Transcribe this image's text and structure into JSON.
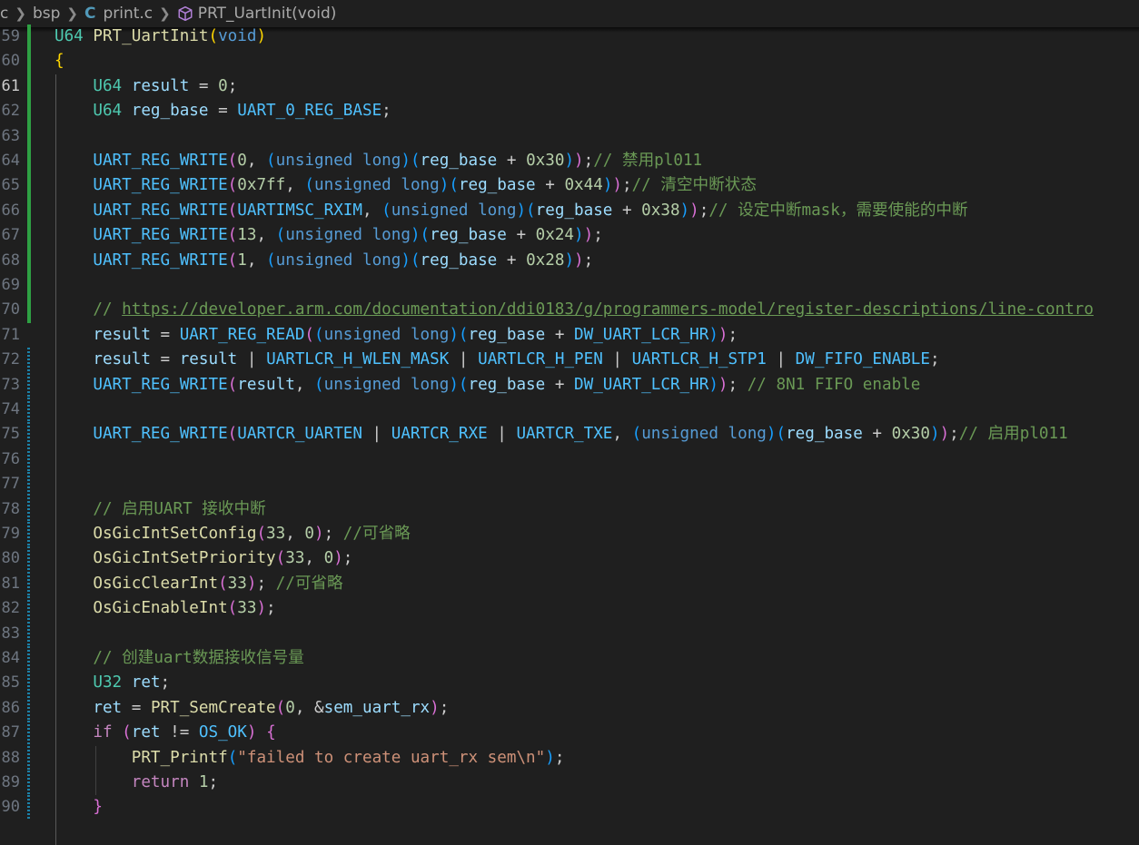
{
  "breadcrumb": {
    "items": [
      "c",
      "bsp",
      "print.c",
      "PRT_UartInit(void)"
    ],
    "icons": [
      "chevron-right-icon",
      "c-file-icon",
      "symbol-method-icon"
    ]
  },
  "editor": {
    "active_line": 61,
    "lines": [
      {
        "n": "59",
        "gutter": "added",
        "tokens": [
          [
            "U64",
            "type"
          ],
          [
            " ",
            "punc"
          ],
          [
            "PRT_UartInit",
            "fn"
          ],
          [
            "(",
            "p1"
          ],
          [
            "void",
            "kw"
          ],
          [
            ")",
            "p1"
          ]
        ]
      },
      {
        "n": "60",
        "gutter": "added",
        "tokens": [
          [
            "{",
            "p1"
          ]
        ]
      },
      {
        "n": "61",
        "gutter": "added",
        "tokens": [
          [
            "    ",
            "punc"
          ],
          [
            "U64",
            "type"
          ],
          [
            " ",
            "punc"
          ],
          [
            "result",
            "var"
          ],
          [
            " = ",
            "punc"
          ],
          [
            "0",
            "num"
          ],
          [
            ";",
            "punc"
          ]
        ]
      },
      {
        "n": "62",
        "gutter": "added",
        "tokens": [
          [
            "    ",
            "punc"
          ],
          [
            "U64",
            "type"
          ],
          [
            " ",
            "punc"
          ],
          [
            "reg_base",
            "var"
          ],
          [
            " = ",
            "punc"
          ],
          [
            "UART_0_REG_BASE",
            "macro"
          ],
          [
            ";",
            "punc"
          ]
        ]
      },
      {
        "n": "63",
        "gutter": "added",
        "tokens": []
      },
      {
        "n": "64",
        "gutter": "added",
        "tokens": [
          [
            "    ",
            "punc"
          ],
          [
            "UART_REG_WRITE",
            "macro"
          ],
          [
            "(",
            "p2"
          ],
          [
            "0",
            "num"
          ],
          [
            ", ",
            "punc"
          ],
          [
            "(",
            "p3"
          ],
          [
            "unsigned long",
            "kw"
          ],
          [
            ")",
            "p3"
          ],
          [
            "(",
            "p3"
          ],
          [
            "reg_base",
            "var"
          ],
          [
            " + ",
            "punc"
          ],
          [
            "0x30",
            "num"
          ],
          [
            ")",
            "p3"
          ],
          [
            ")",
            "p2"
          ],
          [
            ";",
            "punc"
          ],
          [
            "// 禁用pl011",
            "cmt"
          ]
        ]
      },
      {
        "n": "65",
        "gutter": "added",
        "tokens": [
          [
            "    ",
            "punc"
          ],
          [
            "UART_REG_WRITE",
            "macro"
          ],
          [
            "(",
            "p2"
          ],
          [
            "0x7ff",
            "num"
          ],
          [
            ", ",
            "punc"
          ],
          [
            "(",
            "p3"
          ],
          [
            "unsigned long",
            "kw"
          ],
          [
            ")",
            "p3"
          ],
          [
            "(",
            "p3"
          ],
          [
            "reg_base",
            "var"
          ],
          [
            " + ",
            "punc"
          ],
          [
            "0x44",
            "num"
          ],
          [
            ")",
            "p3"
          ],
          [
            ")",
            "p2"
          ],
          [
            ";",
            "punc"
          ],
          [
            "// 清空中断状态",
            "cmt"
          ]
        ]
      },
      {
        "n": "66",
        "gutter": "added",
        "tokens": [
          [
            "    ",
            "punc"
          ],
          [
            "UART_REG_WRITE",
            "macro"
          ],
          [
            "(",
            "p2"
          ],
          [
            "UARTIMSC_RXIM",
            "macro"
          ],
          [
            ", ",
            "punc"
          ],
          [
            "(",
            "p3"
          ],
          [
            "unsigned long",
            "kw"
          ],
          [
            ")",
            "p3"
          ],
          [
            "(",
            "p3"
          ],
          [
            "reg_base",
            "var"
          ],
          [
            " + ",
            "punc"
          ],
          [
            "0x38",
            "num"
          ],
          [
            ")",
            "p3"
          ],
          [
            ")",
            "p2"
          ],
          [
            ";",
            "punc"
          ],
          [
            "// 设定中断mask，需要使能的中断",
            "cmt"
          ]
        ]
      },
      {
        "n": "67",
        "gutter": "added",
        "tokens": [
          [
            "    ",
            "punc"
          ],
          [
            "UART_REG_WRITE",
            "macro"
          ],
          [
            "(",
            "p2"
          ],
          [
            "13",
            "num"
          ],
          [
            ", ",
            "punc"
          ],
          [
            "(",
            "p3"
          ],
          [
            "unsigned long",
            "kw"
          ],
          [
            ")",
            "p3"
          ],
          [
            "(",
            "p3"
          ],
          [
            "reg_base",
            "var"
          ],
          [
            " + ",
            "punc"
          ],
          [
            "0x24",
            "num"
          ],
          [
            ")",
            "p3"
          ],
          [
            ")",
            "p2"
          ],
          [
            ";",
            "punc"
          ]
        ]
      },
      {
        "n": "68",
        "gutter": "added",
        "tokens": [
          [
            "    ",
            "punc"
          ],
          [
            "UART_REG_WRITE",
            "macro"
          ],
          [
            "(",
            "p2"
          ],
          [
            "1",
            "num"
          ],
          [
            ", ",
            "punc"
          ],
          [
            "(",
            "p3"
          ],
          [
            "unsigned long",
            "kw"
          ],
          [
            ")",
            "p3"
          ],
          [
            "(",
            "p3"
          ],
          [
            "reg_base",
            "var"
          ],
          [
            " + ",
            "punc"
          ],
          [
            "0x28",
            "num"
          ],
          [
            ")",
            "p3"
          ],
          [
            ")",
            "p2"
          ],
          [
            ";",
            "punc"
          ]
        ]
      },
      {
        "n": "69",
        "gutter": "added",
        "tokens": []
      },
      {
        "n": "70",
        "gutter": "added",
        "tokens": [
          [
            "    ",
            "punc"
          ],
          [
            "// ",
            "cmt"
          ],
          [
            "https://developer.arm.com/documentation/ddi0183/g/programmers-model/register-descriptions/line-contro",
            "link"
          ]
        ]
      },
      {
        "n": "71",
        "gutter": "none",
        "tokens": [
          [
            "    ",
            "punc"
          ],
          [
            "result",
            "var"
          ],
          [
            " = ",
            "punc"
          ],
          [
            "UART_REG_READ",
            "macro"
          ],
          [
            "(",
            "p2"
          ],
          [
            "(",
            "p3"
          ],
          [
            "unsigned long",
            "kw"
          ],
          [
            ")",
            "p3"
          ],
          [
            "(",
            "p3"
          ],
          [
            "reg_base",
            "var"
          ],
          [
            " + ",
            "punc"
          ],
          [
            "DW_UART_LCR_HR",
            "macro"
          ],
          [
            ")",
            "p3"
          ],
          [
            ")",
            "p2"
          ],
          [
            ";",
            "punc"
          ]
        ]
      },
      {
        "n": "72",
        "gutter": "modified",
        "tokens": [
          [
            "    ",
            "punc"
          ],
          [
            "result",
            "var"
          ],
          [
            " = ",
            "punc"
          ],
          [
            "result",
            "var"
          ],
          [
            " | ",
            "punc"
          ],
          [
            "UARTLCR_H_WLEN_MASK",
            "macro"
          ],
          [
            " | ",
            "punc"
          ],
          [
            "UARTLCR_H_PEN",
            "macro"
          ],
          [
            " | ",
            "punc"
          ],
          [
            "UARTLCR_H_STP1",
            "macro"
          ],
          [
            " | ",
            "punc"
          ],
          [
            "DW_FIFO_ENABLE",
            "macro"
          ],
          [
            ";",
            "punc"
          ]
        ]
      },
      {
        "n": "73",
        "gutter": "modified",
        "tokens": [
          [
            "    ",
            "punc"
          ],
          [
            "UART_REG_WRITE",
            "macro"
          ],
          [
            "(",
            "p2"
          ],
          [
            "result",
            "var"
          ],
          [
            ", ",
            "punc"
          ],
          [
            "(",
            "p3"
          ],
          [
            "unsigned long",
            "kw"
          ],
          [
            ")",
            "p3"
          ],
          [
            "(",
            "p3"
          ],
          [
            "reg_base",
            "var"
          ],
          [
            " + ",
            "punc"
          ],
          [
            "DW_UART_LCR_HR",
            "macro"
          ],
          [
            ")",
            "p3"
          ],
          [
            ")",
            "p2"
          ],
          [
            ";",
            "punc"
          ],
          [
            " // 8N1 FIFO enable",
            "cmt"
          ]
        ]
      },
      {
        "n": "74",
        "gutter": "modified",
        "tokens": []
      },
      {
        "n": "75",
        "gutter": "modified",
        "tokens": [
          [
            "    ",
            "punc"
          ],
          [
            "UART_REG_WRITE",
            "macro"
          ],
          [
            "(",
            "p2"
          ],
          [
            "UARTCR_UARTEN",
            "macro"
          ],
          [
            " | ",
            "punc"
          ],
          [
            "UARTCR_RXE",
            "macro"
          ],
          [
            " | ",
            "punc"
          ],
          [
            "UARTCR_TXE",
            "macro"
          ],
          [
            ", ",
            "punc"
          ],
          [
            "(",
            "p3"
          ],
          [
            "unsigned long",
            "kw"
          ],
          [
            ")",
            "p3"
          ],
          [
            "(",
            "p3"
          ],
          [
            "reg_base",
            "var"
          ],
          [
            " + ",
            "punc"
          ],
          [
            "0x30",
            "num"
          ],
          [
            ")",
            "p3"
          ],
          [
            ")",
            "p2"
          ],
          [
            ";",
            "punc"
          ],
          [
            "// 启用pl011",
            "cmt"
          ]
        ]
      },
      {
        "n": "76",
        "gutter": "modified",
        "tokens": []
      },
      {
        "n": "77",
        "gutter": "modified",
        "tokens": []
      },
      {
        "n": "78",
        "gutter": "modified",
        "tokens": [
          [
            "    ",
            "punc"
          ],
          [
            "// 启用UART 接收中断",
            "cmt"
          ]
        ]
      },
      {
        "n": "79",
        "gutter": "modified",
        "tokens": [
          [
            "    ",
            "punc"
          ],
          [
            "OsGicIntSetConfig",
            "fn"
          ],
          [
            "(",
            "p2"
          ],
          [
            "33",
            "num"
          ],
          [
            ", ",
            "punc"
          ],
          [
            "0",
            "num"
          ],
          [
            ")",
            "p2"
          ],
          [
            "; ",
            "punc"
          ],
          [
            "//可省略",
            "cmt"
          ]
        ]
      },
      {
        "n": "80",
        "gutter": "modified",
        "tokens": [
          [
            "    ",
            "punc"
          ],
          [
            "OsGicIntSetPriority",
            "fn"
          ],
          [
            "(",
            "p2"
          ],
          [
            "33",
            "num"
          ],
          [
            ", ",
            "punc"
          ],
          [
            "0",
            "num"
          ],
          [
            ")",
            "p2"
          ],
          [
            ";",
            "punc"
          ]
        ]
      },
      {
        "n": "81",
        "gutter": "modified",
        "tokens": [
          [
            "    ",
            "punc"
          ],
          [
            "OsGicClearInt",
            "fn"
          ],
          [
            "(",
            "p2"
          ],
          [
            "33",
            "num"
          ],
          [
            ")",
            "p2"
          ],
          [
            "; ",
            "punc"
          ],
          [
            "//可省略",
            "cmt"
          ]
        ]
      },
      {
        "n": "82",
        "gutter": "modified",
        "tokens": [
          [
            "    ",
            "punc"
          ],
          [
            "OsGicEnableInt",
            "fn"
          ],
          [
            "(",
            "p2"
          ],
          [
            "33",
            "num"
          ],
          [
            ")",
            "p2"
          ],
          [
            ";",
            "punc"
          ]
        ]
      },
      {
        "n": "83",
        "gutter": "modified",
        "tokens": []
      },
      {
        "n": "84",
        "gutter": "modified",
        "tokens": [
          [
            "    ",
            "punc"
          ],
          [
            "// 创建uart数据接收信号量",
            "cmt"
          ]
        ]
      },
      {
        "n": "85",
        "gutter": "modified",
        "tokens": [
          [
            "    ",
            "punc"
          ],
          [
            "U32",
            "type"
          ],
          [
            " ",
            "punc"
          ],
          [
            "ret",
            "var"
          ],
          [
            ";",
            "punc"
          ]
        ]
      },
      {
        "n": "86",
        "gutter": "modified",
        "tokens": [
          [
            "    ",
            "punc"
          ],
          [
            "ret",
            "var"
          ],
          [
            " = ",
            "punc"
          ],
          [
            "PRT_SemCreate",
            "fn"
          ],
          [
            "(",
            "p2"
          ],
          [
            "0",
            "num"
          ],
          [
            ", &",
            "punc"
          ],
          [
            "sem_uart_rx",
            "var"
          ],
          [
            ")",
            "p2"
          ],
          [
            ";",
            "punc"
          ]
        ]
      },
      {
        "n": "87",
        "gutter": "modified",
        "tokens": [
          [
            "    ",
            "punc"
          ],
          [
            "if",
            "ctrl"
          ],
          [
            " ",
            "punc"
          ],
          [
            "(",
            "p2"
          ],
          [
            "ret",
            "var"
          ],
          [
            " != ",
            "punc"
          ],
          [
            "OS_OK",
            "macro"
          ],
          [
            ")",
            "p2"
          ],
          [
            " ",
            "punc"
          ],
          [
            "{",
            "p2"
          ]
        ]
      },
      {
        "n": "88",
        "gutter": "modified",
        "tokens": [
          [
            "        ",
            "punc"
          ],
          [
            "PRT_Printf",
            "fn"
          ],
          [
            "(",
            "p3"
          ],
          [
            "\"failed to create uart_rx sem\\n\"",
            "str"
          ],
          [
            ")",
            "p3"
          ],
          [
            ";",
            "punc"
          ]
        ]
      },
      {
        "n": "89",
        "gutter": "modified",
        "tokens": [
          [
            "        ",
            "punc"
          ],
          [
            "return",
            "ctrl"
          ],
          [
            " ",
            "punc"
          ],
          [
            "1",
            "num"
          ],
          [
            ";",
            "punc"
          ]
        ]
      },
      {
        "n": "90",
        "gutter": "modified",
        "tokens": [
          [
            "    ",
            "punc"
          ],
          [
            "}",
            "p2"
          ]
        ]
      }
    ]
  },
  "colors": {
    "background": "#1f1f1f",
    "gutter_added": "#2ea043",
    "gutter_modified": "#1b81a8"
  }
}
